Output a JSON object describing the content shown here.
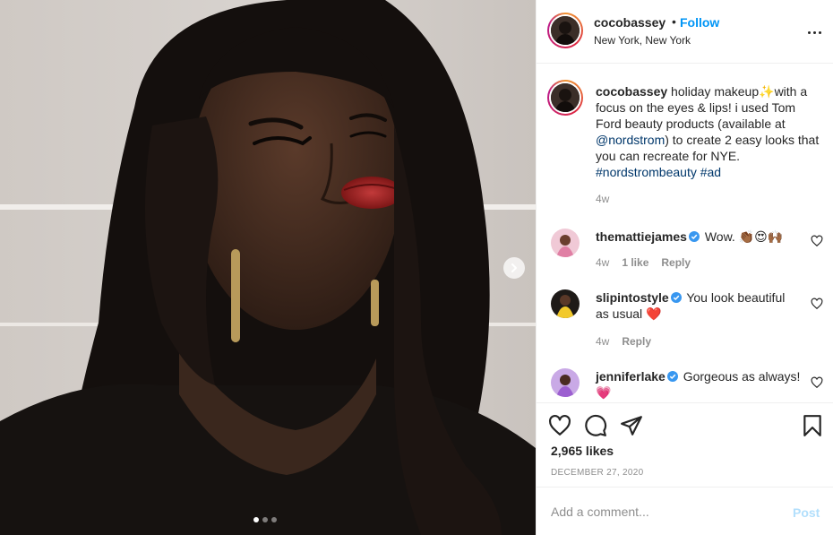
{
  "post": {
    "username": "cocobassey",
    "separator": "•",
    "follow_label": "Follow",
    "location": "New York, New York",
    "more_icon": "more-horizontal-icon",
    "next_icon": "chevron-right-icon",
    "carousel": {
      "count": 3,
      "active_index": 1
    }
  },
  "caption": {
    "username": "cocobassey",
    "text_1": " holiday makeup",
    "sparkle": "✨",
    "text_2": "with a focus on the eyes & lips! i used Tom Ford beauty products (available at ",
    "mention": "@nordstrom",
    "text_3": ") to create 2 easy looks that you can recreate for NYE. ",
    "hashtag_1": "#nordstrombeauty",
    "hashtag_2": "#ad",
    "time": "4w"
  },
  "comments": [
    {
      "username": "themattiejames",
      "text": "Wow. ",
      "emoji": "👏🏾😍🙌🏾",
      "time": "4w",
      "likes": "1 like",
      "reply": "Reply"
    },
    {
      "username": "slipintostyle",
      "text": "You look beautiful as usual ",
      "emoji": "❤️",
      "time": "4w",
      "reply": "Reply"
    },
    {
      "username": "jenniferlake",
      "text": "Gorgeous as always! ",
      "emoji": "💗"
    }
  ],
  "actions": {
    "likes": "2,965 likes",
    "date": "DECEMBER 27, 2020",
    "icons": [
      "heart-icon",
      "comment-icon",
      "share-icon",
      "bookmark-icon"
    ]
  },
  "add_comment": {
    "placeholder": "Add a comment...",
    "post_label": "Post"
  },
  "colors": {
    "link": "#00376b",
    "follow": "#0095f6",
    "verified": "#3897f0",
    "post_disabled": "#b2dffc",
    "muted": "#8e8e8e"
  }
}
